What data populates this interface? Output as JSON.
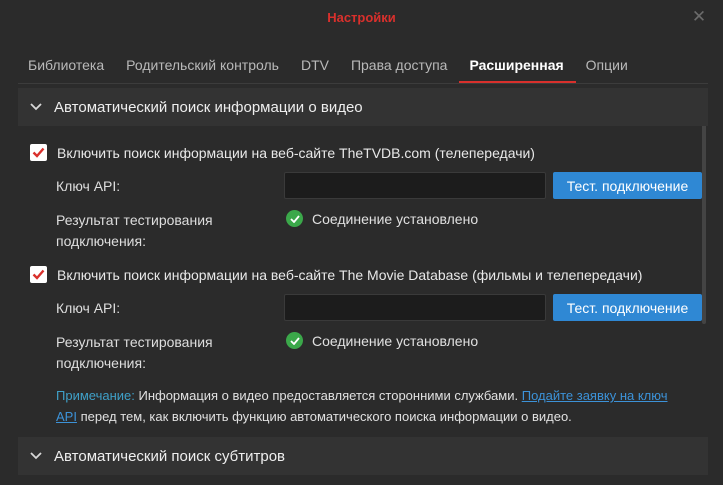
{
  "window": {
    "title": "Настройки",
    "close_symbol": "✕"
  },
  "tabs": [
    {
      "label": "Библиотека",
      "active": false
    },
    {
      "label": "Родительский контроль",
      "active": false
    },
    {
      "label": "DTV",
      "active": false
    },
    {
      "label": "Права доступа",
      "active": false
    },
    {
      "label": "Расширенная",
      "active": true
    },
    {
      "label": "Опции",
      "active": false
    }
  ],
  "section_video": {
    "title": "Автоматический поиск информации о видео",
    "expanded": true,
    "tvdb": {
      "checkbox_label": "Включить поиск информации на веб-сайте TheTVDB.com (телепередачи)",
      "checked": true,
      "api_key_label": "Ключ API:",
      "api_key_value": "",
      "test_button": "Тест. подключение",
      "result_label": "Результат тестирования подключения:",
      "result_text": "Соединение установлено"
    },
    "tmdb": {
      "checkbox_label": "Включить поиск информации на веб-сайте The Movie Database (фильмы и телепередачи)",
      "checked": true,
      "api_key_label": "Ключ API:",
      "api_key_value": "",
      "test_button": "Тест. подключение",
      "result_label": "Результат тестирования подключения:",
      "result_text": "Соединение установлено"
    },
    "note": {
      "label": "Примечание:",
      "text_before": " Информация о видео предоставляется сторонними службами. ",
      "link": "Подайте заявку на ключ API",
      "text_after": " перед тем, как включить функцию автоматического поиска информации о видео."
    }
  },
  "section_subtitles": {
    "title": "Автоматический поиск субтитров",
    "expanded": true
  },
  "colors": {
    "accent_red": "#d9302c",
    "button_blue": "#2f88d4",
    "success_green": "#3ba84a",
    "link_blue": "#3c92d8",
    "note_label": "#3fa0c8"
  },
  "icons": {
    "close": "close-icon",
    "chevron": "chevron-down-icon",
    "checkmark": "checkmark-icon",
    "success": "success-check-icon"
  }
}
